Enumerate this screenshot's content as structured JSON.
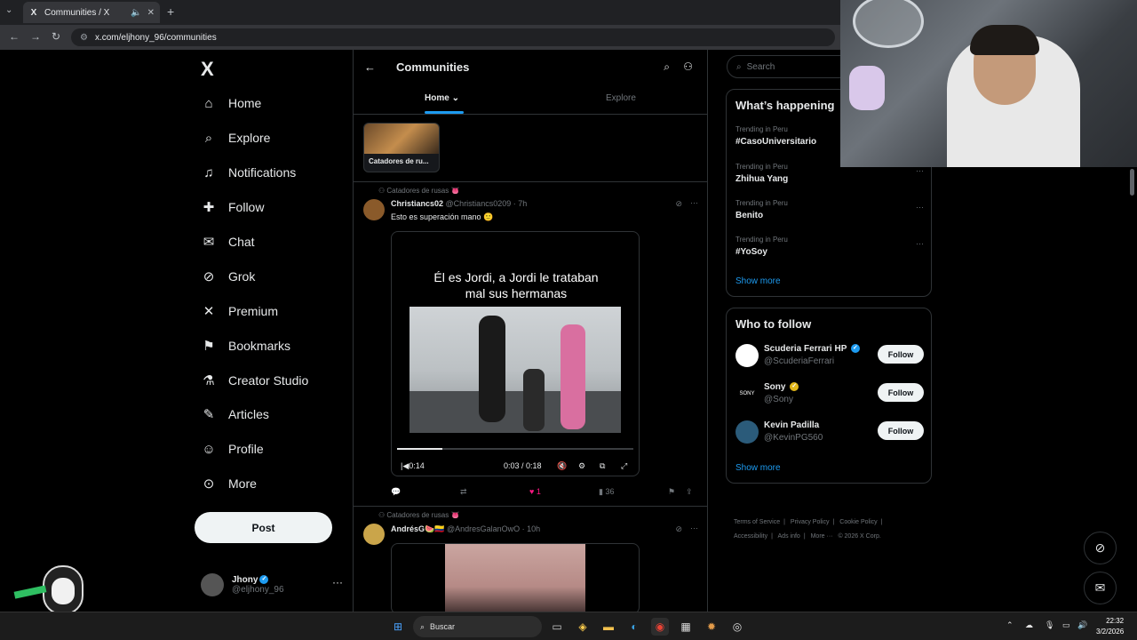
{
  "browser": {
    "tab_title": "Communities / X",
    "url": "x.com/eljhony_96/communities",
    "new_tab": "+"
  },
  "nav": {
    "logo": "X",
    "items": [
      {
        "label": "Home",
        "icon": "home-icon",
        "glyph": "⌂"
      },
      {
        "label": "Explore",
        "icon": "search-icon",
        "glyph": "⌕"
      },
      {
        "label": "Notifications",
        "icon": "bell-icon",
        "glyph": "🔔"
      },
      {
        "label": "Follow",
        "icon": "person-add-icon",
        "glyph": "👤"
      },
      {
        "label": "Chat",
        "icon": "mail-icon",
        "glyph": "✉"
      },
      {
        "label": "Grok",
        "icon": "grok-icon",
        "glyph": "⊘"
      },
      {
        "label": "Premium",
        "icon": "x-icon",
        "glyph": "✕"
      },
      {
        "label": "Bookmarks",
        "icon": "bookmark-icon",
        "glyph": "⚑"
      },
      {
        "label": "Creator Studio",
        "icon": "flask-icon",
        "glyph": "⚗"
      },
      {
        "label": "Articles",
        "icon": "article-icon",
        "glyph": "✎"
      },
      {
        "label": "Profile",
        "icon": "profile-icon",
        "glyph": "👤"
      },
      {
        "label": "More",
        "icon": "more-circle-icon",
        "glyph": "⋯"
      }
    ],
    "post_label": "Post",
    "account": {
      "name": "Jhony",
      "handle": "@eljhony_96"
    }
  },
  "main": {
    "title": "Communities",
    "tabs": {
      "home": "Home",
      "explore": "Explore"
    },
    "community_card": "Catadores de ru...",
    "posts": [
      {
        "community": "Catadores de rusas 👅",
        "name": "Christiancs02",
        "handle": "@Christiancs0209 · 7h",
        "text": "Esto es superación mano 🙂",
        "caption_line1": "Él es Jordi, a Jordi le trataban",
        "caption_line2": "mal sus hermanas",
        "video_time": "0:03 / 0:18",
        "video_left": "0:14",
        "progress": 0.19,
        "likes": "1",
        "views": "36"
      },
      {
        "community": "Catadores de rusas 👅",
        "name": "AndrésG🍉🇨🇴",
        "handle": "@AndresGalanOwO · 10h"
      }
    ]
  },
  "right": {
    "search_placeholder": "Search",
    "happening_title": "What’s happening",
    "trends": [
      {
        "context": "Trending in Peru",
        "name": "#CasoUniversitario"
      },
      {
        "context": "Trending in Peru",
        "name": "Zhihua Yang"
      },
      {
        "context": "Trending in Peru",
        "name": "Benito"
      },
      {
        "context": "Trending in Peru",
        "name": "#YoSoy"
      }
    ],
    "show_more": "Show more",
    "wtf_title": "Who to follow",
    "follow_label": "Follow",
    "suggestions": [
      {
        "name": "Scuderia Ferrari HP",
        "handle": "@ScuderiaFerrari",
        "color": "#ffffff"
      },
      {
        "name": "Sony",
        "handle": "@Sony",
        "color": "#000000"
      },
      {
        "name": "Kevin Padilla",
        "handle": "@KevinPG560",
        "color": "#2b5b7a"
      }
    ],
    "footer": [
      "Terms of Service",
      "|",
      "Privacy Policy",
      "|",
      "Cookie Policy",
      "|",
      "Accessibility",
      "|",
      "Ads info",
      "|",
      "More ···",
      "© 2026 X Corp."
    ]
  },
  "taskbar": {
    "search": "Buscar",
    "time": "22:32",
    "date": "3/2/2026"
  },
  "colors": {
    "accent": "#1d9bf0",
    "like": "#f91880"
  }
}
